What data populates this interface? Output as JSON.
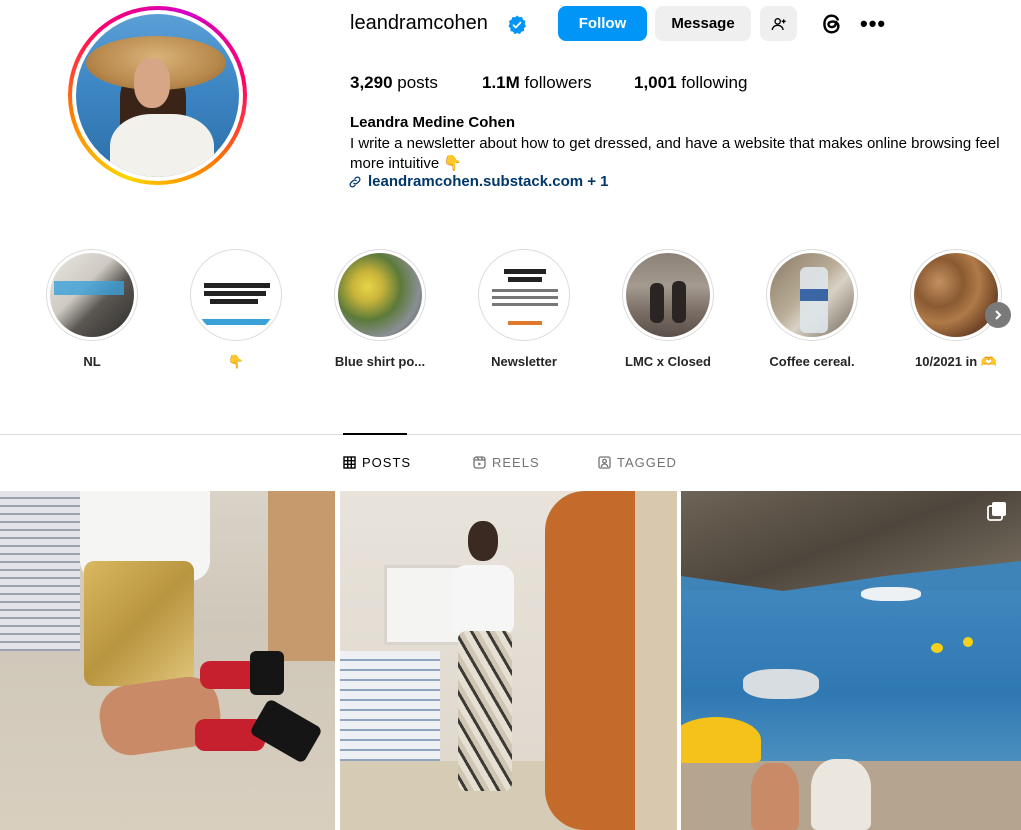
{
  "profile": {
    "username": "leandramcohen",
    "verified": true,
    "follow_label": "Follow",
    "message_label": "Message",
    "stats": {
      "posts_value": "3,290",
      "posts_label": " posts",
      "followers_value": "1.1M",
      "followers_label": " followers",
      "following_value": "1,001",
      "following_label": " following"
    },
    "bio": {
      "name": "Leandra Medine Cohen",
      "text": "I write a newsletter about how to get dressed, and have a website that makes online browsing feel more intuitive 👇",
      "link": "leandramcohen.substack.com + 1"
    }
  },
  "highlights": [
    {
      "label": "NL"
    },
    {
      "label": "👇"
    },
    {
      "label": "Blue shirt po..."
    },
    {
      "label": "Newsletter"
    },
    {
      "label": "LMC x Closed"
    },
    {
      "label": "Coffee cereal."
    },
    {
      "label": "10/2021 in 🫶"
    }
  ],
  "tabs": {
    "posts": "POSTS",
    "reels": "REELS",
    "tagged": "TAGGED"
  },
  "colors": {
    "follow_button": "#0095f6",
    "secondary_button": "#efefef",
    "link": "#00376b",
    "divider": "#dbdbdb",
    "muted_text": "#737373"
  }
}
